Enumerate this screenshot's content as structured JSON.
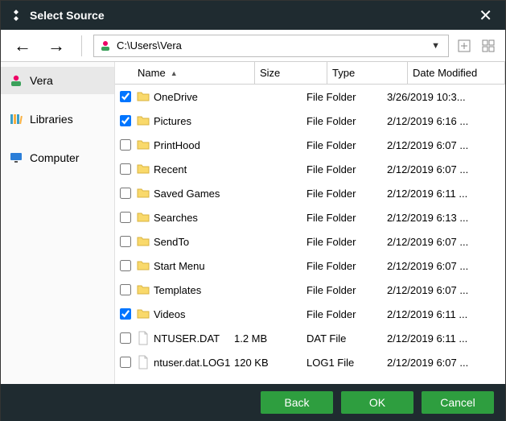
{
  "window": {
    "title": "Select Source"
  },
  "path": "C:\\Users\\Vera",
  "sidebar": [
    {
      "key": "vera",
      "label": "Vera",
      "icon": "user",
      "active": true
    },
    {
      "key": "libraries",
      "label": "Libraries",
      "icon": "libraries",
      "active": false
    },
    {
      "key": "computer",
      "label": "Computer",
      "icon": "monitor",
      "active": false
    }
  ],
  "columns": {
    "name": "Name",
    "size": "Size",
    "type": "Type",
    "date": "Date Modified"
  },
  "rows": [
    {
      "checked": true,
      "icon": "folder",
      "name": "OneDrive",
      "size": "",
      "type": "File Folder",
      "date": "3/26/2019 10:3..."
    },
    {
      "checked": true,
      "icon": "folder",
      "name": "Pictures",
      "size": "",
      "type": "File Folder",
      "date": "2/12/2019 6:16 ..."
    },
    {
      "checked": false,
      "icon": "folder",
      "name": "PrintHood",
      "size": "",
      "type": "File Folder",
      "date": "2/12/2019 6:07 ..."
    },
    {
      "checked": false,
      "icon": "folder",
      "name": "Recent",
      "size": "",
      "type": "File Folder",
      "date": "2/12/2019 6:07 ..."
    },
    {
      "checked": false,
      "icon": "folder",
      "name": "Saved Games",
      "size": "",
      "type": "File Folder",
      "date": "2/12/2019 6:11 ..."
    },
    {
      "checked": false,
      "icon": "folder",
      "name": "Searches",
      "size": "",
      "type": "File Folder",
      "date": "2/12/2019 6:13 ..."
    },
    {
      "checked": false,
      "icon": "folder",
      "name": "SendTo",
      "size": "",
      "type": "File Folder",
      "date": "2/12/2019 6:07 ..."
    },
    {
      "checked": false,
      "icon": "folder",
      "name": "Start Menu",
      "size": "",
      "type": "File Folder",
      "date": "2/12/2019 6:07 ..."
    },
    {
      "checked": false,
      "icon": "folder",
      "name": "Templates",
      "size": "",
      "type": "File Folder",
      "date": "2/12/2019 6:07 ..."
    },
    {
      "checked": true,
      "icon": "folder",
      "name": "Videos",
      "size": "",
      "type": "File Folder",
      "date": "2/12/2019 6:11 ..."
    },
    {
      "checked": false,
      "icon": "file",
      "name": "NTUSER.DAT",
      "size": "1.2 MB",
      "type": "DAT File",
      "date": "2/12/2019 6:11 ..."
    },
    {
      "checked": false,
      "icon": "file",
      "name": "ntuser.dat.LOG1",
      "size": "120 KB",
      "type": "LOG1 File",
      "date": "2/12/2019 6:07 ..."
    }
  ],
  "buttons": {
    "back": "Back",
    "ok": "OK",
    "cancel": "Cancel"
  }
}
